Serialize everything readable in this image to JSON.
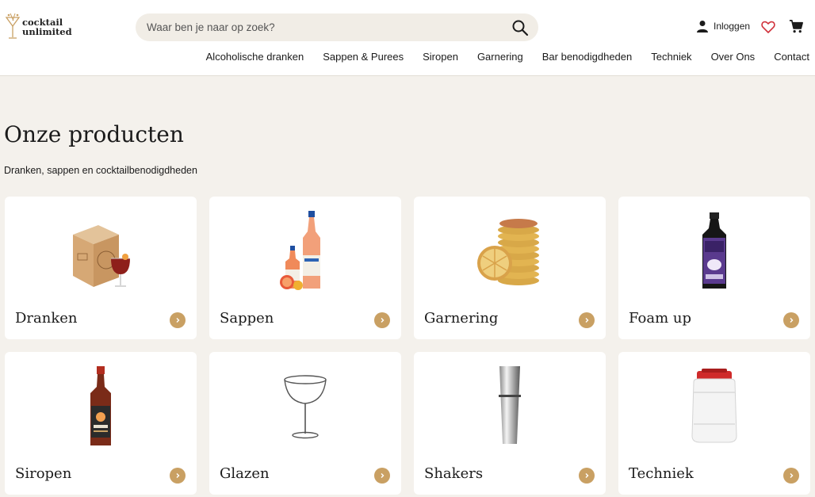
{
  "brand": {
    "line1": "cocktail",
    "line2": "unlimited"
  },
  "search": {
    "placeholder": "Waar ben je naar op zoek?"
  },
  "account": {
    "login_label": "Inloggen"
  },
  "nav": {
    "items": [
      {
        "label": "Alcoholische dranken"
      },
      {
        "label": "Sappen & Purees"
      },
      {
        "label": "Siropen"
      },
      {
        "label": "Garnering"
      },
      {
        "label": "Bar benodigdheden"
      },
      {
        "label": "Techniek"
      },
      {
        "label": "Over Ons"
      },
      {
        "label": "Contact"
      }
    ]
  },
  "page": {
    "title": "Onze producten",
    "subtitle": "Dranken, sappen en cocktailbenodigdheden"
  },
  "categories": [
    {
      "label": "Dranken",
      "icon": "drinks-box-icon"
    },
    {
      "label": "Sappen",
      "icon": "juice-bottles-icon"
    },
    {
      "label": "Garnering",
      "icon": "dried-citrus-icon"
    },
    {
      "label": "Foam up",
      "icon": "foam-bottle-icon"
    },
    {
      "label": "Siropen",
      "icon": "syrup-bottle-icon"
    },
    {
      "label": "Glazen",
      "icon": "coupe-glass-icon"
    },
    {
      "label": "Shakers",
      "icon": "shaker-icon"
    },
    {
      "label": "Techniek",
      "icon": "drum-container-icon"
    }
  ],
  "colors": {
    "accent": "#c9a063",
    "background": "#f4f1ec",
    "heart": "#d0303a"
  }
}
